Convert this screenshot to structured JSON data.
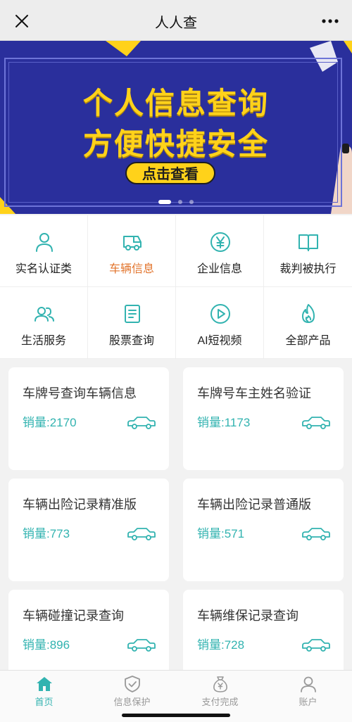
{
  "titlebar": {
    "title": "人人查",
    "close_icon": "close-icon",
    "more_icon": "more-icon"
  },
  "banner": {
    "headline": "个人信息查询",
    "subheadline": "方便快捷安全",
    "cta": "点击查看",
    "slides": 3,
    "active_slide": 1,
    "colors": {
      "background": "#2a2f9c",
      "text": "#ffd21a"
    }
  },
  "categories": [
    {
      "label": "实名认证类",
      "icon": "user-icon",
      "active": false
    },
    {
      "label": "车辆信息",
      "icon": "truck-icon",
      "active": true
    },
    {
      "label": "企业信息",
      "icon": "yen-icon",
      "active": false
    },
    {
      "label": "裁判被执行",
      "icon": "book-icon",
      "active": false
    },
    {
      "label": "生活服务",
      "icon": "users-icon",
      "active": false
    },
    {
      "label": "股票查询",
      "icon": "document-icon",
      "active": false
    },
    {
      "label": "AI短视频",
      "icon": "play-icon",
      "active": false
    },
    {
      "label": "全部产品",
      "icon": "fire-icon",
      "active": false
    }
  ],
  "products": [
    {
      "name": "车牌号查询车辆信息",
      "sales": "销量:2170"
    },
    {
      "name": "车牌号车主姓名验证",
      "sales": "销量:1173"
    },
    {
      "name": "车辆出险记录精准版",
      "sales": "销量:773"
    },
    {
      "name": "车辆出险记录普通版",
      "sales": "销量:571"
    },
    {
      "name": "车辆碰撞记录查询",
      "sales": "销量:896"
    },
    {
      "name": "车辆维保记录查询",
      "sales": "销量:728"
    }
  ],
  "tabs": [
    {
      "label": "首页",
      "icon": "home-icon",
      "active": true
    },
    {
      "label": "信息保护",
      "icon": "shield-icon",
      "active": false
    },
    {
      "label": "支付完成",
      "icon": "money-bag-icon",
      "active": false
    },
    {
      "label": "账户",
      "icon": "account-icon",
      "active": false
    }
  ],
  "colors": {
    "accent": "#32b3b0",
    "active_category": "#e2742c"
  }
}
